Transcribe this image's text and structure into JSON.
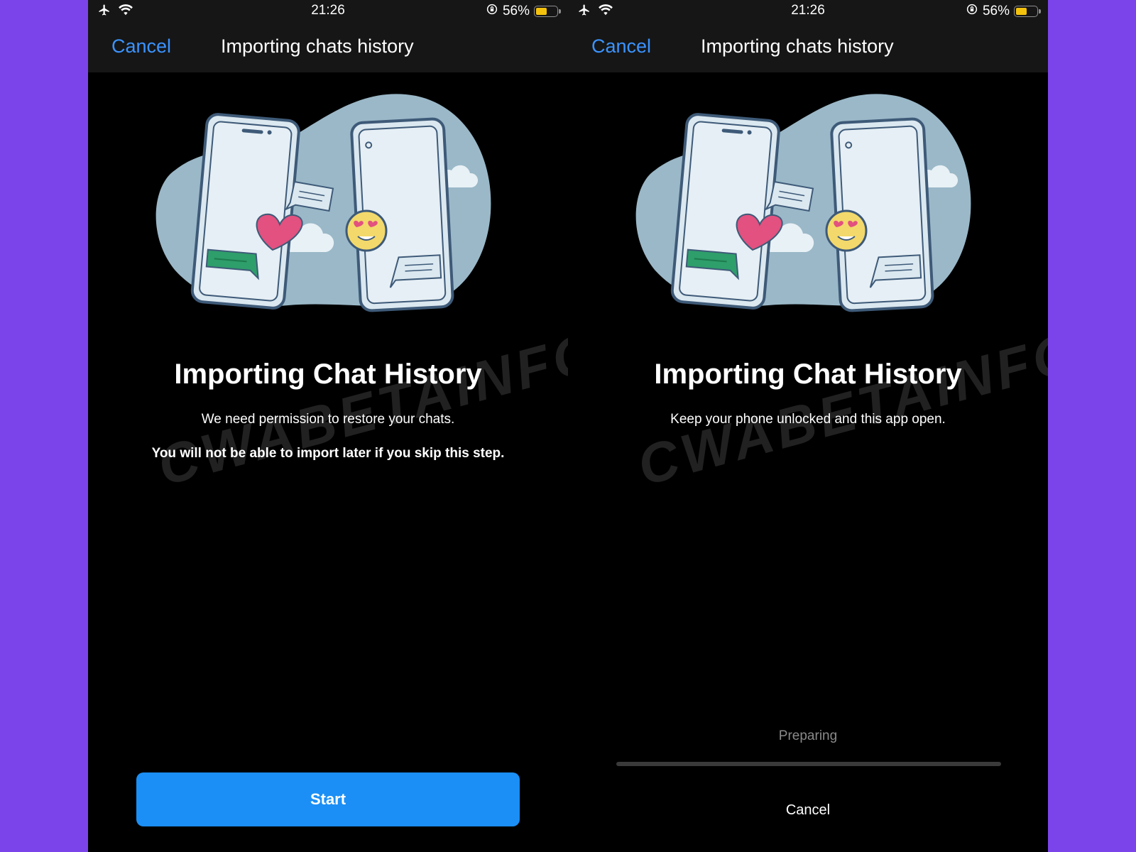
{
  "status_bar": {
    "time": "21:26",
    "battery_text": "56%",
    "battery_level": 0.56
  },
  "nav": {
    "cancel_label": "Cancel",
    "title": "Importing chats history"
  },
  "watermark": "CWABETAINFO",
  "left_screen": {
    "headline": "Importing Chat History",
    "subtext": "We need permission to restore your chats.",
    "warning": "You will not be able to import later if you skip this step.",
    "start_label": "Start"
  },
  "right_screen": {
    "headline": "Importing Chat History",
    "subtext": "Keep your phone unlocked and this app open.",
    "progress_label": "Preparing",
    "progress": 0,
    "cancel_label": "Cancel"
  },
  "colors": {
    "background": "#7b44ea",
    "accent": "#1b8ff5",
    "link": "#3b93ff",
    "battery": "#f4c20d"
  }
}
